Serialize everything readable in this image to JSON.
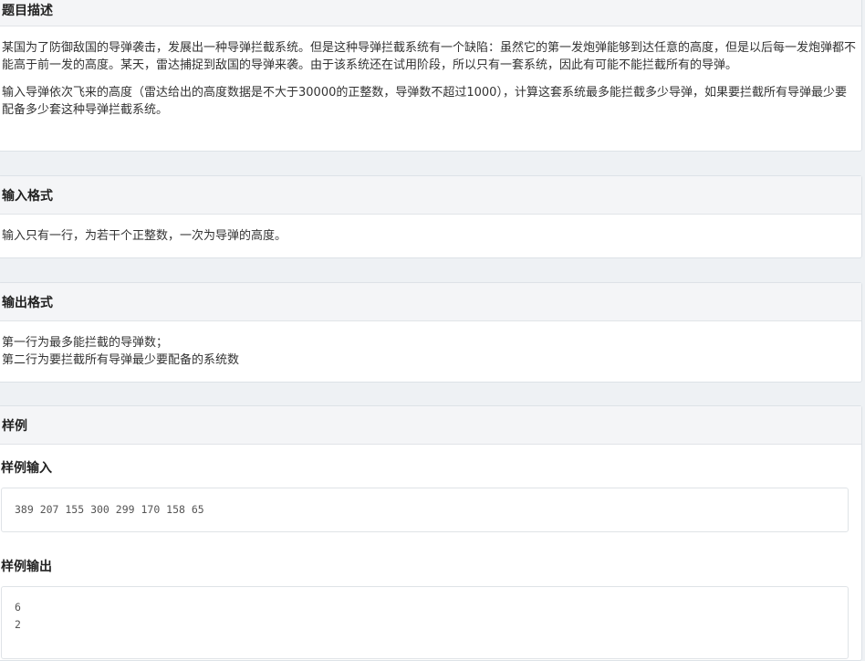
{
  "description": {
    "title": "题目描述",
    "paragraphs": [
      "某国为了防御敌国的导弹袭击，发展出一种导弹拦截系统。但是这种导弹拦截系统有一个缺陷：虽然它的第一发炮弹能够到达任意的高度，但是以后每一发炮弹都不能高于前一发的高度。某天，雷达捕捉到敌国的导弹来袭。由于该系统还在试用阶段，所以只有一套系统，因此有可能不能拦截所有的导弹。",
      "输入导弹依次飞来的高度（雷达给出的高度数据是不大于30000的正整数，导弹数不超过1000），计算这套系统最多能拦截多少导弹，如果要拦截所有导弹最少要配备多少套这种导弹拦截系统。"
    ]
  },
  "input_format": {
    "title": "输入格式",
    "text": "输入只有一行，为若干个正整数，一次为导弹的高度。"
  },
  "output_format": {
    "title": "输出格式",
    "lines": [
      "第一行为最多能拦截的导弹数；",
      "第二行为要拦截所有导弹最少要配备的系统数"
    ]
  },
  "sample": {
    "title": "样例",
    "input_title": "样例输入",
    "input_lines": [
      "389 207 155 300 299 170 158 65"
    ],
    "output_title": "样例输出",
    "output_lines": [
      "6",
      "2"
    ]
  }
}
